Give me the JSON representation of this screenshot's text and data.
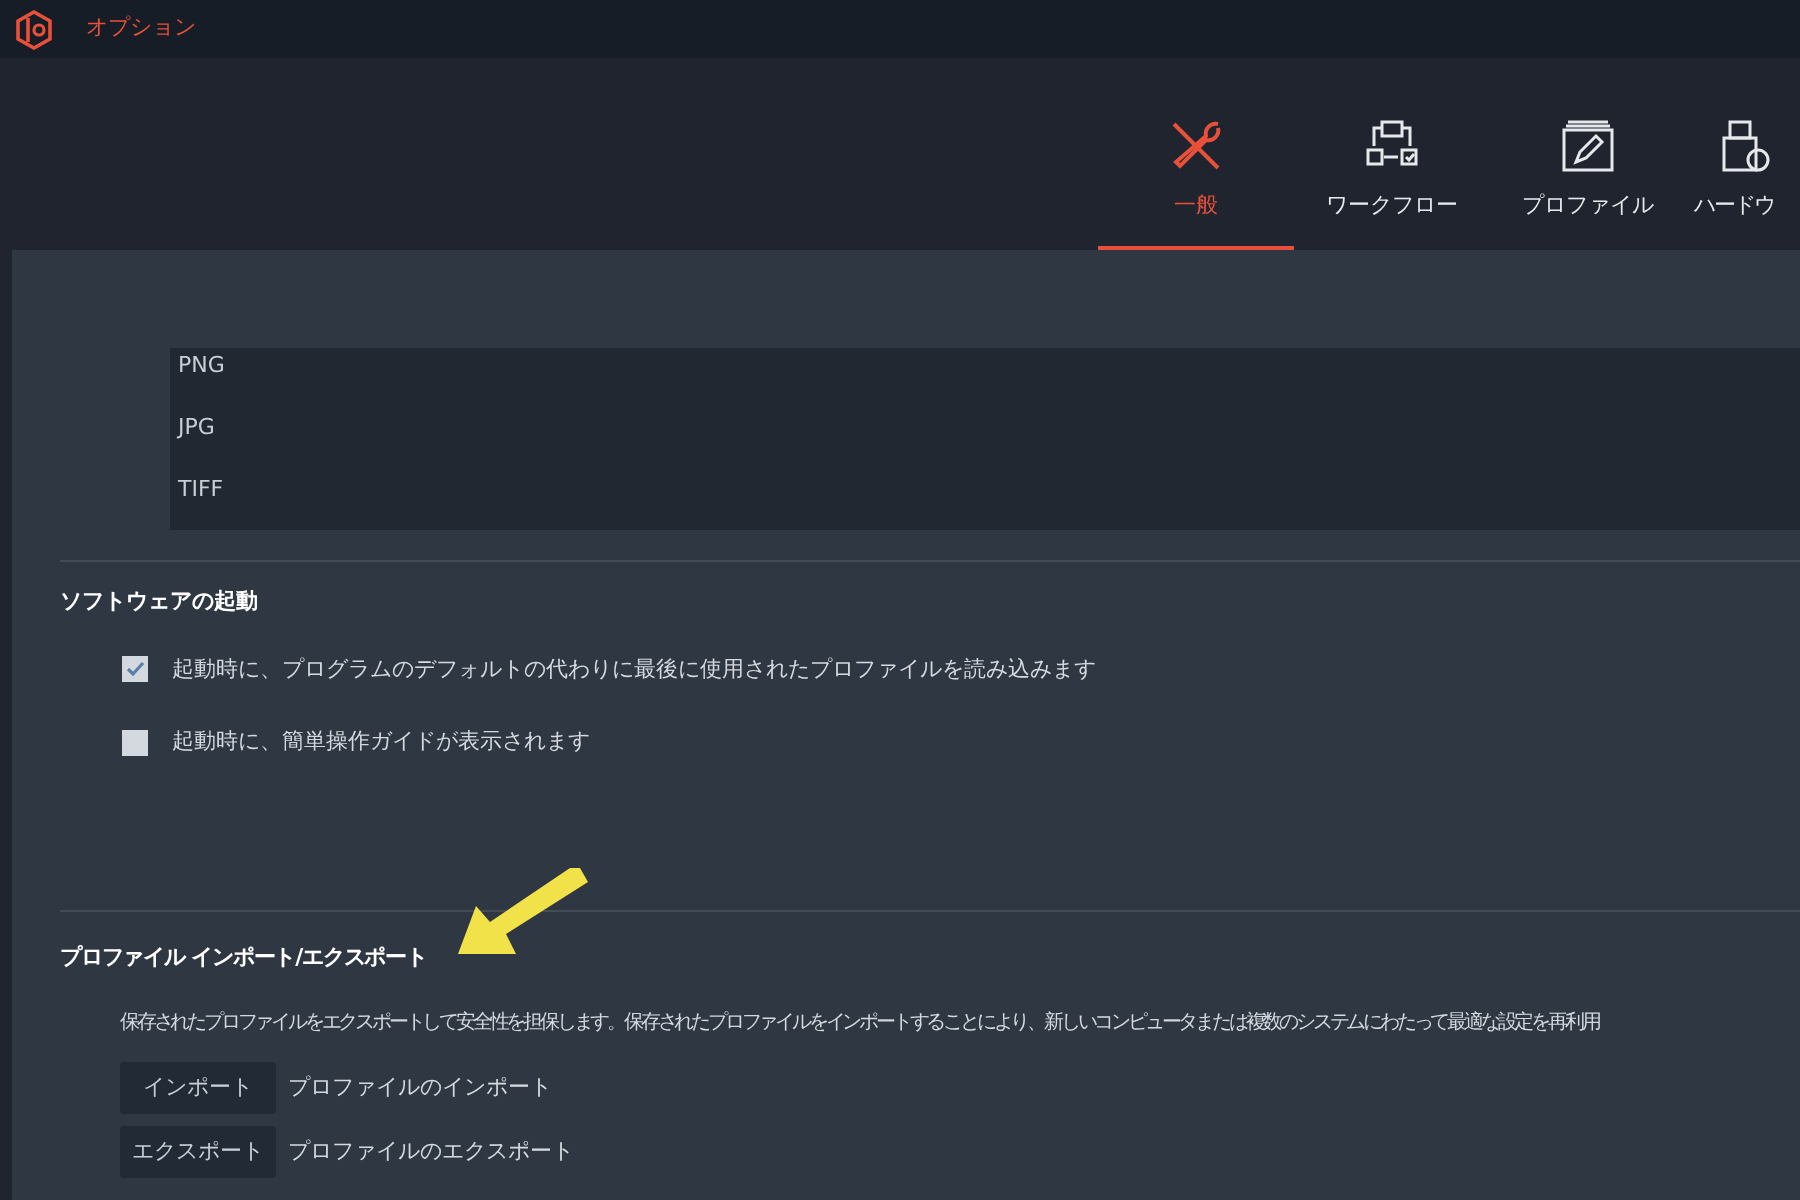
{
  "window": {
    "title": "オプション"
  },
  "tabs": [
    {
      "label": "一般",
      "selected": true
    },
    {
      "label": "ワークフロー",
      "selected": false
    },
    {
      "label": "プロファイル",
      "selected": false
    },
    {
      "label": "ハードウ",
      "selected": false
    }
  ],
  "formats": [
    "PNG",
    "JPG",
    "TIFF"
  ],
  "startup": {
    "title": "ソフトウェアの起動",
    "options": [
      {
        "label": "起動時に、プログラムのデフォルトの代わりに最後に使用されたプロファイルを読み込みます",
        "checked": true
      },
      {
        "label": "起動時に、簡単操作ガイドが表示されます",
        "checked": false
      }
    ]
  },
  "profile_io": {
    "title": "プロファイル インポート/エクスポート",
    "description": "保存されたプロファイルをエクスポートして安全性を担保します。保存されたプロファイルをインポートすることにより、新しいコンピュータまたは複数のシステムにわたって最適な設定を再利用",
    "actions": [
      {
        "button": "インポート",
        "label": "プロファイルのインポート"
      },
      {
        "button": "エクスポート",
        "label": "プロファイルのエクスポート"
      }
    ]
  }
}
